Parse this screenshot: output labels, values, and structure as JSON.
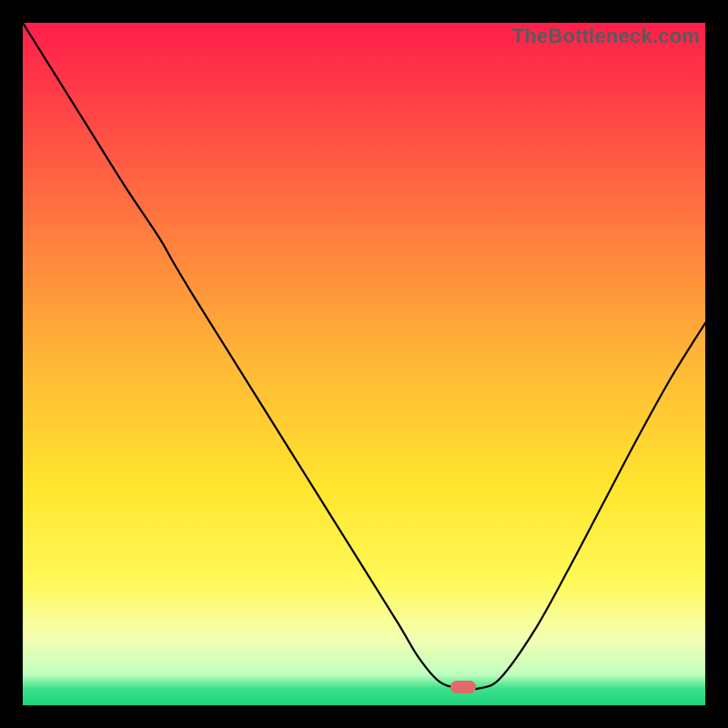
{
  "watermark": "TheBottleneck.com",
  "marker": {
    "color": "#e26a6a",
    "x_pct": 64.5,
    "y_pct": 97.3
  },
  "gradient_stops": [
    {
      "offset": 0.0,
      "color": "#ff1f4b"
    },
    {
      "offset": 0.1,
      "color": "#ff3b47"
    },
    {
      "offset": 0.3,
      "color": "#ff7a3f"
    },
    {
      "offset": 0.5,
      "color": "#ffb836"
    },
    {
      "offset": 0.68,
      "color": "#ffe52e"
    },
    {
      "offset": 0.82,
      "color": "#fff95a"
    },
    {
      "offset": 0.9,
      "color": "#f5ffb0"
    },
    {
      "offset": 0.955,
      "color": "#bfffbf"
    },
    {
      "offset": 0.975,
      "color": "#3fe28a"
    },
    {
      "offset": 1.0,
      "color": "#1ad47b"
    }
  ],
  "chart_data": {
    "type": "line",
    "title": "",
    "xlabel": "",
    "ylabel": "",
    "xlim": [
      0,
      100
    ],
    "ylim": [
      0,
      100
    ],
    "x": [
      0,
      5,
      10,
      15,
      20,
      22,
      25,
      30,
      35,
      40,
      45,
      50,
      55,
      58,
      61,
      64,
      67,
      70,
      75,
      80,
      85,
      90,
      95,
      100
    ],
    "values": [
      100,
      92,
      84,
      76,
      68.5,
      65,
      60,
      52,
      44,
      36,
      28,
      20,
      12,
      7,
      3.5,
      2.5,
      2.5,
      4,
      11,
      20,
      29.5,
      39,
      48,
      56
    ],
    "baseline_y": 2.5,
    "optimal_x": 64.5,
    "note": "x and y are percentages of the plot area; curve read off pixel positions from the image. y increases upward (100 = top)."
  }
}
